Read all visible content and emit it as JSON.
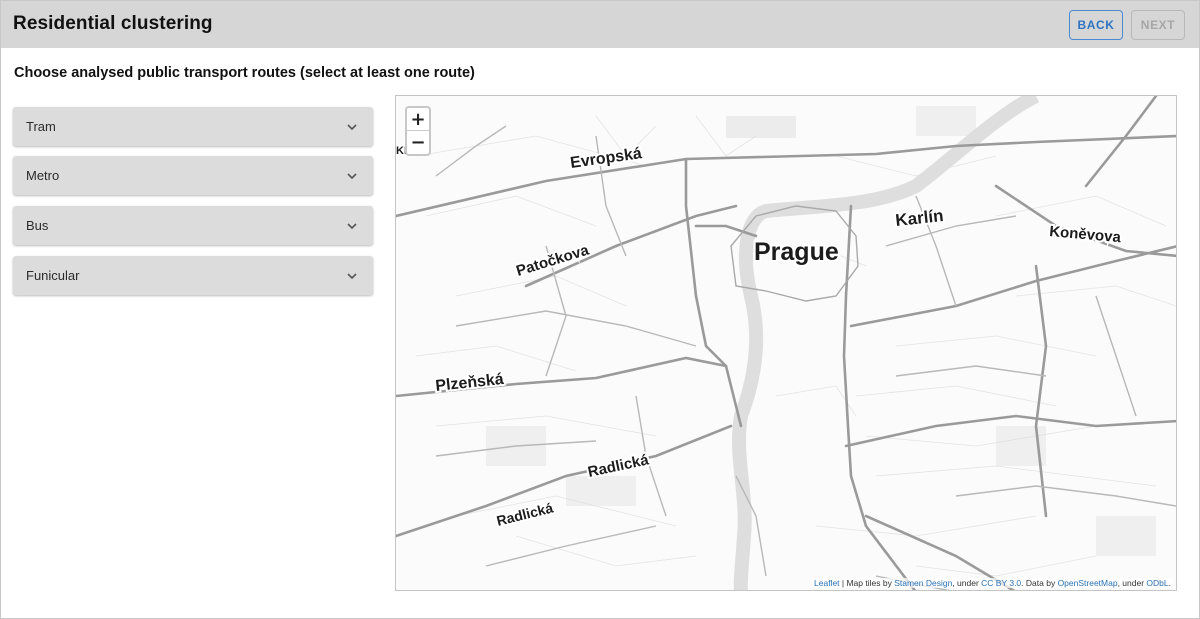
{
  "header": {
    "title": "Residential clustering",
    "back_label": "BACK",
    "next_label": "NEXT"
  },
  "subtitle": "Choose analysed public transport routes (select at least one route)",
  "route_panels": [
    {
      "label": "Tram"
    },
    {
      "label": "Metro"
    },
    {
      "label": "Bus"
    },
    {
      "label": "Funicular"
    }
  ],
  "map": {
    "zoom_in": "+",
    "zoom_out": "−",
    "labels": {
      "evropska": "Evropská",
      "karlin": "Karlín",
      "prague": "Prague",
      "konevova": "Koněvova",
      "patockova": "Patočkova",
      "plzenska": "Plzeňská",
      "radlicka_1": "Radlická",
      "radlicka_2": "Radlická",
      "edge": "KB"
    },
    "attribution": {
      "leaflet": "Leaflet",
      "sep1": " | Map tiles by ",
      "stamen": "Stamen Design",
      "sep2": ", under ",
      "ccby": "CC BY 3.0",
      "sep3": ". Data by ",
      "osm": "OpenStreetMap",
      "sep4": ", under ",
      "odbl": "ODbL",
      "end": "."
    }
  },
  "colors": {
    "header_bg": "#d6d6d6",
    "panel_bg": "#dcdcdc",
    "accent": "#2f74c0",
    "disabled": "#a6a6a6"
  }
}
